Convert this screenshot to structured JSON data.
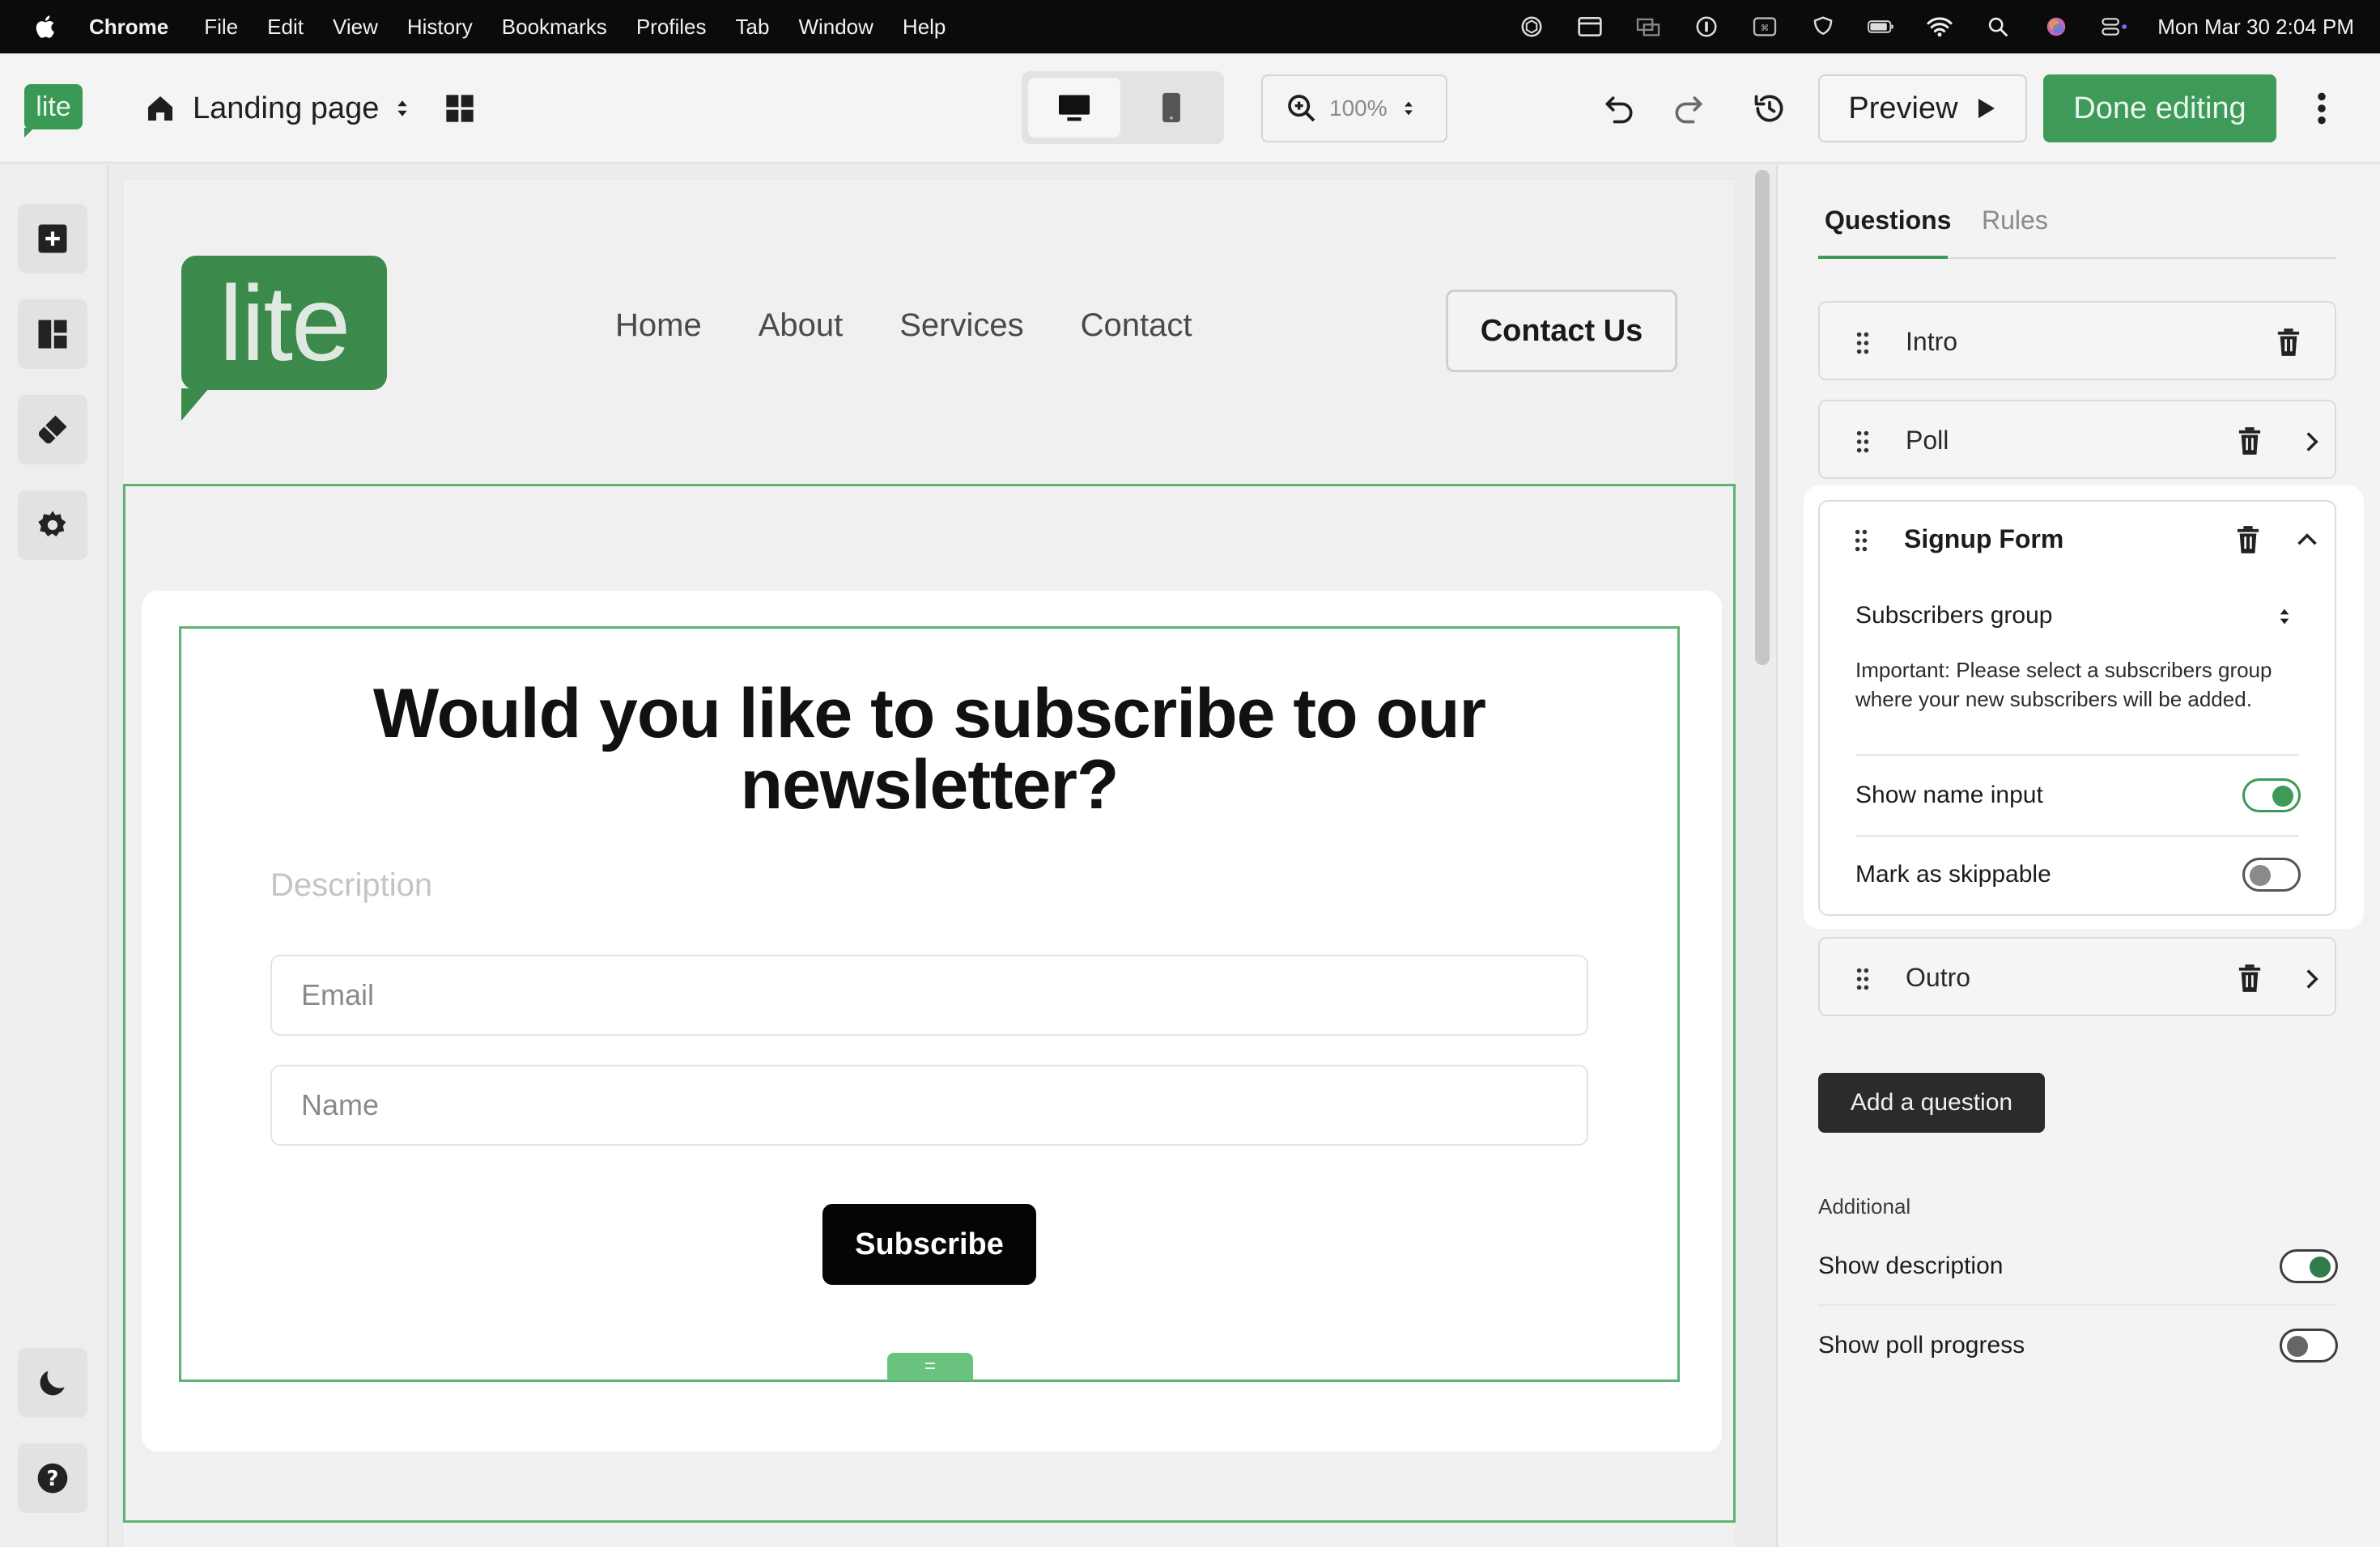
{
  "menubar": {
    "app": "Chrome",
    "items": [
      "File",
      "Edit",
      "View",
      "History",
      "Bookmarks",
      "Profiles",
      "Tab",
      "Window",
      "Help"
    ],
    "clock": "Mon Mar 30  2:04 PM"
  },
  "topbar": {
    "logo": "lite",
    "page_name": "Landing page",
    "zoom": "100%",
    "preview_label": "Preview",
    "done_label": "Done editing"
  },
  "site": {
    "logo": "lite",
    "nav": [
      "Home",
      "About",
      "Services",
      "Contact"
    ],
    "contact_button": "Contact Us"
  },
  "modal": {
    "title": "Would you like to subscribe to our newsletter?",
    "description_placeholder": "Description",
    "email_placeholder": "Email",
    "name_placeholder": "Name",
    "subscribe_label": "Subscribe",
    "handle": "="
  },
  "panel": {
    "tabs": [
      "Questions",
      "Rules"
    ],
    "questions": {
      "intro": "Intro",
      "poll": "Poll",
      "signup": "Signup Form",
      "outro": "Outro"
    },
    "signup": {
      "subscribers_group": "Subscribers group",
      "important": "Important: Please select a subscribers group where your new subscribers will be added.",
      "show_name_input": "Show name input",
      "show_name_input_on": true,
      "mark_skippable": "Mark as skippable",
      "mark_skippable_on": false
    },
    "add_question": "Add a question",
    "additional": "Additional",
    "show_description": "Show description",
    "show_description_on": true,
    "show_poll_progress": "Show poll progress",
    "show_poll_progress_on": false
  },
  "colors": {
    "brand_green": "#3d9a58",
    "outline_green": "#5fb274"
  }
}
